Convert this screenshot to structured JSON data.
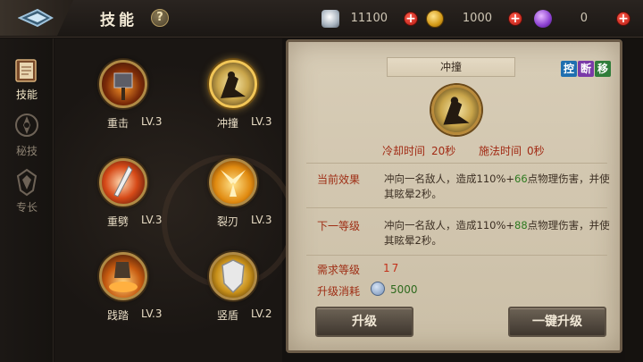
{
  "header": {
    "title": "技能",
    "help_label": "?",
    "resources": [
      {
        "name": "diamond",
        "icon": "diamond-icon",
        "value": "11100"
      },
      {
        "name": "gold",
        "icon": "gold-coin-icon",
        "value": "1000"
      },
      {
        "name": "crystal",
        "icon": "purple-crystal-icon",
        "value": "0"
      }
    ]
  },
  "nav": {
    "items": [
      {
        "label": "技能",
        "icon": "book-icon",
        "active": true
      },
      {
        "label": "秘技",
        "icon": "secret-emblem-icon",
        "active": false
      },
      {
        "label": "专长",
        "icon": "specialty-emblem-icon",
        "active": false
      }
    ]
  },
  "skills": [
    {
      "name": "重击",
      "level": "LV.3",
      "icon": "heavy-strike-icon",
      "selected": false
    },
    {
      "name": "冲撞",
      "level": "LV.3",
      "icon": "charge-icon",
      "selected": true
    },
    {
      "name": "重劈",
      "level": "LV.3",
      "icon": "heavy-slash-icon",
      "selected": false
    },
    {
      "name": "裂刃",
      "level": "LV.3",
      "icon": "split-blade-icon",
      "selected": false
    },
    {
      "name": "践踏",
      "level": "LV.3",
      "icon": "stomp-icon",
      "selected": false
    },
    {
      "name": "竖盾",
      "level": "LV.2",
      "icon": "shield-icon",
      "selected": false
    }
  ],
  "detail": {
    "title": "冲撞",
    "tags": [
      {
        "text": "控",
        "color": "#1f6fb0"
      },
      {
        "text": "断",
        "color": "#7a3aa8"
      },
      {
        "text": "移",
        "color": "#2f7d3a"
      }
    ],
    "cooldown_label": "冷却时间",
    "cooldown_value": "20秒",
    "cast_label": "施法时间",
    "cast_value": "0秒",
    "current_label": "当前效果",
    "current_text_pre": "冲向一名敌人，造成110%+",
    "current_text_hl": "66",
    "current_text_post": "点物理伤害，并使其眩晕2秒。",
    "next_label": "下一等级",
    "next_text_pre": "冲向一名敌人，造成110%+",
    "next_text_hl": "88",
    "next_text_post": "点物理伤害，并使其眩晕2秒。",
    "req_label": "需求等级",
    "req_value": "17",
    "cost_label": "升级消耗",
    "cost_value": "5000",
    "upgrade_label": "升级",
    "upgrade_all_label": "一键升级"
  },
  "colors": {
    "accent_gold": "#f2c657",
    "label_red": "#9e2d14",
    "highlight_green": "#2e7a20"
  }
}
